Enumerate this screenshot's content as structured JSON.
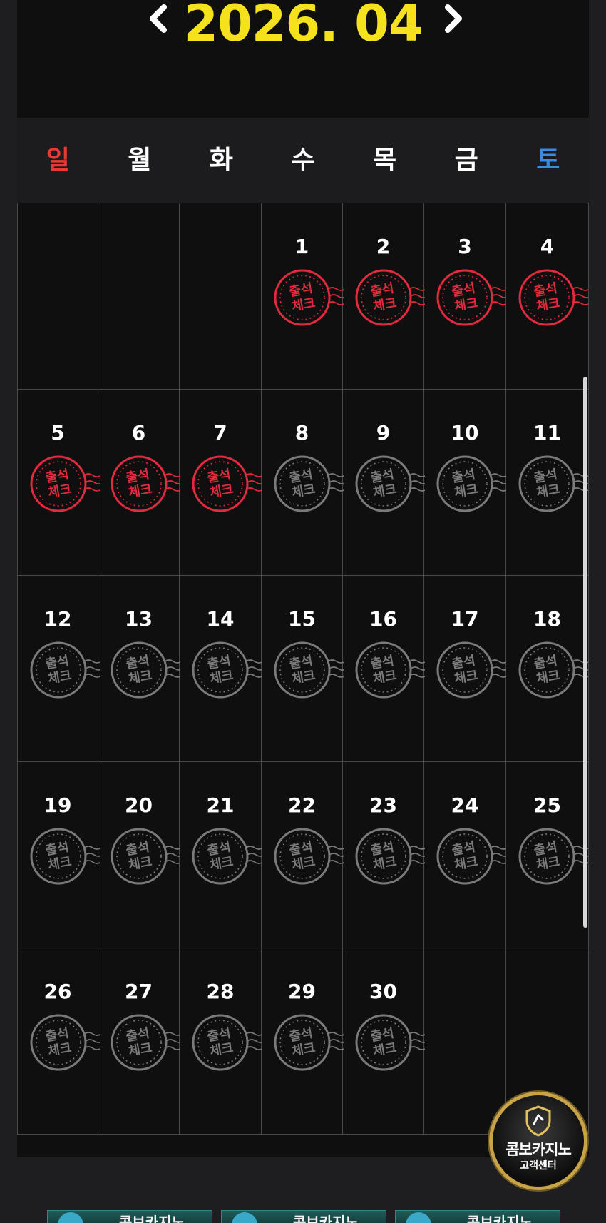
{
  "calendar": {
    "month_label": "2026. 04",
    "weekdays": [
      "일",
      "월",
      "화",
      "수",
      "목",
      "금",
      "토"
    ],
    "stamp_text": [
      "출석",
      "체크"
    ],
    "leading_blank_days": 3,
    "days_in_month": 30,
    "checked_days": [
      1,
      2,
      3,
      4,
      5,
      6,
      7
    ]
  },
  "colors": {
    "title": "#f5e21c",
    "sunday": "#e73a36",
    "saturday": "#3d8be0",
    "stamp_checked": "#e22a3e",
    "stamp_unchecked": "#7a7a7a"
  },
  "icons": {
    "prev": "chevron-left-icon",
    "next": "chevron-right-icon",
    "support": "shield-icon"
  },
  "support": {
    "line1": "콤보카지노",
    "line2": "고객센터"
  },
  "banners": [
    {
      "label": "콤보카지노"
    },
    {
      "label": "콤보카지노"
    },
    {
      "label": "콤보카지노"
    }
  ]
}
